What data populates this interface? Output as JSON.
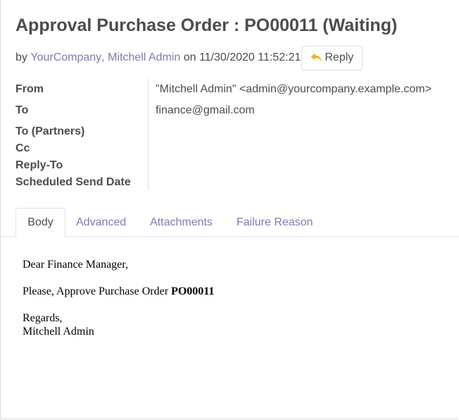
{
  "header": {
    "title": "Approval Purchase Order : PO00011 (Waiting)",
    "by_prefix": "by",
    "author_company": "YourCompany",
    "author_separator": ",",
    "author_name": "Mitchell Admin",
    "on_word": "on",
    "datetime": "11/30/2020 11:52:21",
    "reply_label": "Reply",
    "reply_icon": "reply-arrow-icon",
    "reply_icon_color": "#f0b429"
  },
  "fields": [
    {
      "label": "From",
      "value": "\"Mitchell Admin\" <admin@yourcompany.example.com>"
    },
    {
      "label": "To",
      "value": "finance@gmail.com"
    },
    {
      "label": "To (Partners)",
      "value": ""
    },
    {
      "label": "Cc",
      "value": ""
    },
    {
      "label": "Reply-To",
      "value": ""
    },
    {
      "label": "Scheduled Send Date",
      "value": ""
    }
  ],
  "tabs": [
    {
      "label": "Body",
      "active": true
    },
    {
      "label": "Advanced",
      "active": false
    },
    {
      "label": "Attachments",
      "active": false
    },
    {
      "label": "Failure Reason",
      "active": false
    }
  ],
  "body": {
    "greeting": "Dear Finance Manager,",
    "line_prefix": "Please, Approve Purchase Order ",
    "line_order": "PO00011",
    "closing": "Regards,",
    "signature": "Mitchell Admin"
  },
  "colors": {
    "link": "#7c7bad",
    "text": "#4c4c4c",
    "accent_icon": "#f0b429"
  }
}
